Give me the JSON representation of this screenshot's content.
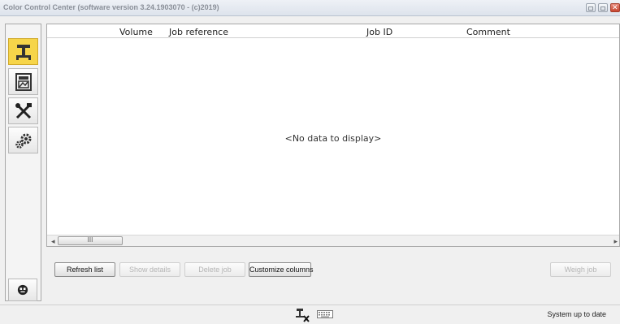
{
  "window": {
    "title": "Color Control Center (software version 3.24.1903070 - (c)2019)"
  },
  "sidebar": {
    "items": [
      {
        "name": "scale",
        "icon": "scale-icon",
        "active": true
      },
      {
        "name": "formula-database",
        "icon": "image-database-icon",
        "active": false
      },
      {
        "name": "tools",
        "icon": "tools-icon",
        "active": false
      },
      {
        "name": "settings",
        "icon": "gears-icon",
        "active": false
      }
    ],
    "helper_icon": "face-icon"
  },
  "grid": {
    "columns": [
      "Volume",
      "Job reference",
      "Job ID",
      "Comment"
    ],
    "rows": [],
    "empty_text": "<No data to display>",
    "scroll_thumb": "III"
  },
  "buttons": {
    "refresh": "Refresh list",
    "show_details": "Show details",
    "delete_job": "Delete job",
    "customize_columns": "Customize columns",
    "weigh_job": "Weigh job"
  },
  "status": {
    "text": "System up to date",
    "icons": [
      "scale-disconnected-icon",
      "keyboard-icon"
    ]
  },
  "colors": {
    "active_accent": "#f6d54a"
  }
}
